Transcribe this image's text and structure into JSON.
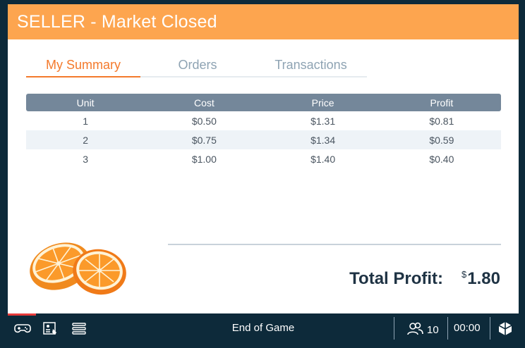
{
  "header": {
    "title": "SELLER - Market Closed"
  },
  "tabs": [
    {
      "label": "My Summary",
      "active": true
    },
    {
      "label": "Orders",
      "active": false
    },
    {
      "label": "Transactions",
      "active": false
    }
  ],
  "table": {
    "columns": [
      "Unit",
      "Cost",
      "Price",
      "Profit"
    ],
    "rows": [
      [
        "1",
        "$0.50",
        "$1.31",
        "$0.81"
      ],
      [
        "2",
        "$0.75",
        "$1.34",
        "$0.59"
      ],
      [
        "3",
        "$1.00",
        "$1.40",
        "$0.40"
      ]
    ]
  },
  "total": {
    "label": "Total Profit:",
    "currency": "$",
    "value": "1.80"
  },
  "footer": {
    "status": "End of Game",
    "players": "10",
    "clock": "00:00",
    "progress": 0.055,
    "icons": [
      "gamepad-icon",
      "id-card-icon",
      "list-icon",
      "users-icon",
      "logo-icon"
    ]
  },
  "colors": {
    "header": "#fda54f",
    "accent": "#f47a2c",
    "table_header": "#74879a",
    "footer": "#0d2a3a",
    "progress": "#e83a3a"
  },
  "image": {
    "subject": "orange-halves"
  }
}
